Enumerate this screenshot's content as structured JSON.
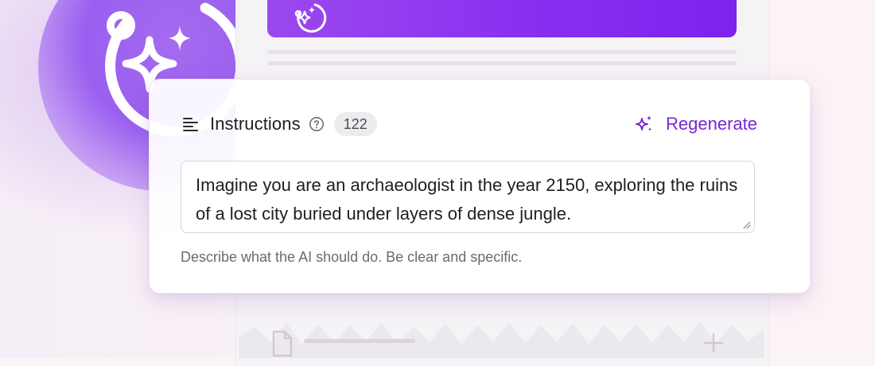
{
  "card": {
    "title": "Instructions",
    "char_count": "122",
    "regenerate_label": "Regenerate",
    "instructions_value": "Imagine you are an archaeologist in the year 2150, exploring the ruins of a lost city buried under layers of dense jungle.",
    "helper_text": "Describe what the AI should do. Be clear and specific."
  },
  "icons": {
    "menu": "menu-lines-icon",
    "help": "question-circle-icon",
    "regenerate": "sparkles-icon",
    "logo": "sparkles-orbit-icon",
    "document": "document-icon",
    "add": "plus-icon"
  },
  "colors": {
    "accent": "#7c24d6",
    "bar_start": "#9b49ee",
    "bar_end": "#7d22ee",
    "badge_bg": "#ecebee"
  }
}
